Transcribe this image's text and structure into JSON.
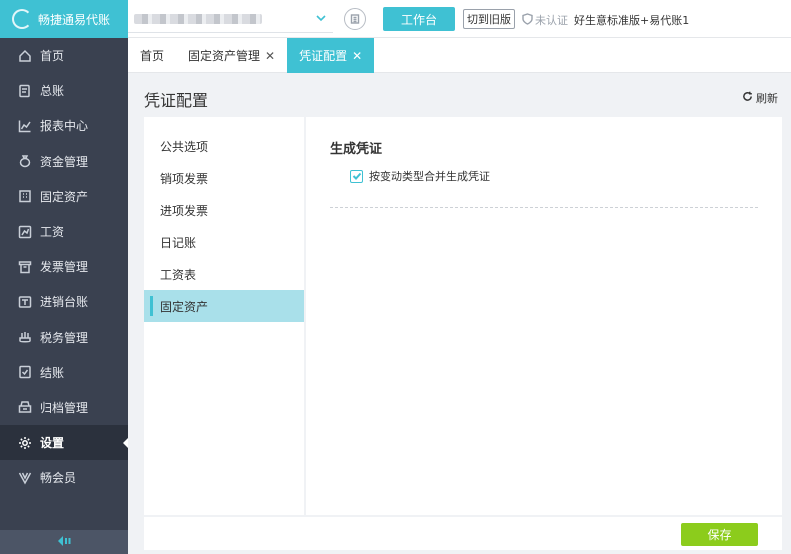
{
  "app": {
    "brand": "畅捷通易代账"
  },
  "header": {
    "workbench_label": "工作台",
    "old_version_label": "切到旧版",
    "cert_status": "未认证",
    "plan_name": "好生意标准版+易代账1"
  },
  "sidebar": {
    "items": [
      {
        "label": "首页",
        "icon": "home-icon"
      },
      {
        "label": "总账",
        "icon": "ledger-icon"
      },
      {
        "label": "报表中心",
        "icon": "chart-icon"
      },
      {
        "label": "资金管理",
        "icon": "money-bag-icon"
      },
      {
        "label": "固定资产",
        "icon": "building-icon"
      },
      {
        "label": "工资",
        "icon": "salary-icon"
      },
      {
        "label": "发票管理",
        "icon": "invoice-icon"
      },
      {
        "label": "进销台账",
        "icon": "register-icon"
      },
      {
        "label": "税务管理",
        "icon": "tax-icon"
      },
      {
        "label": "结账",
        "icon": "checkout-icon"
      },
      {
        "label": "归档管理",
        "icon": "archive-icon"
      },
      {
        "label": "设置",
        "icon": "gear-icon",
        "active": true
      },
      {
        "label": "畅会员",
        "icon": "vip-icon"
      }
    ]
  },
  "tabs": [
    {
      "label": "首页",
      "closable": false
    },
    {
      "label": "固定资产管理",
      "closable": true
    },
    {
      "label": "凭证配置",
      "closable": true,
      "active": true
    }
  ],
  "page": {
    "title": "凭证配置",
    "refresh_label": "刷新"
  },
  "left_menu": {
    "items": [
      {
        "label": "公共选项"
      },
      {
        "label": "销项发票"
      },
      {
        "label": "进项发票"
      },
      {
        "label": "日记账"
      },
      {
        "label": "工资表"
      },
      {
        "label": "固定资产",
        "active": true
      }
    ]
  },
  "panel": {
    "section_title": "生成凭证",
    "checkbox_label": "按变动类型合并生成凭证",
    "checkbox_checked": true
  },
  "footer": {
    "save_label": "保存"
  },
  "colors": {
    "accent": "#3fc1d3",
    "sidebar_bg": "#3a4150",
    "save_green": "#8ccc1c"
  }
}
